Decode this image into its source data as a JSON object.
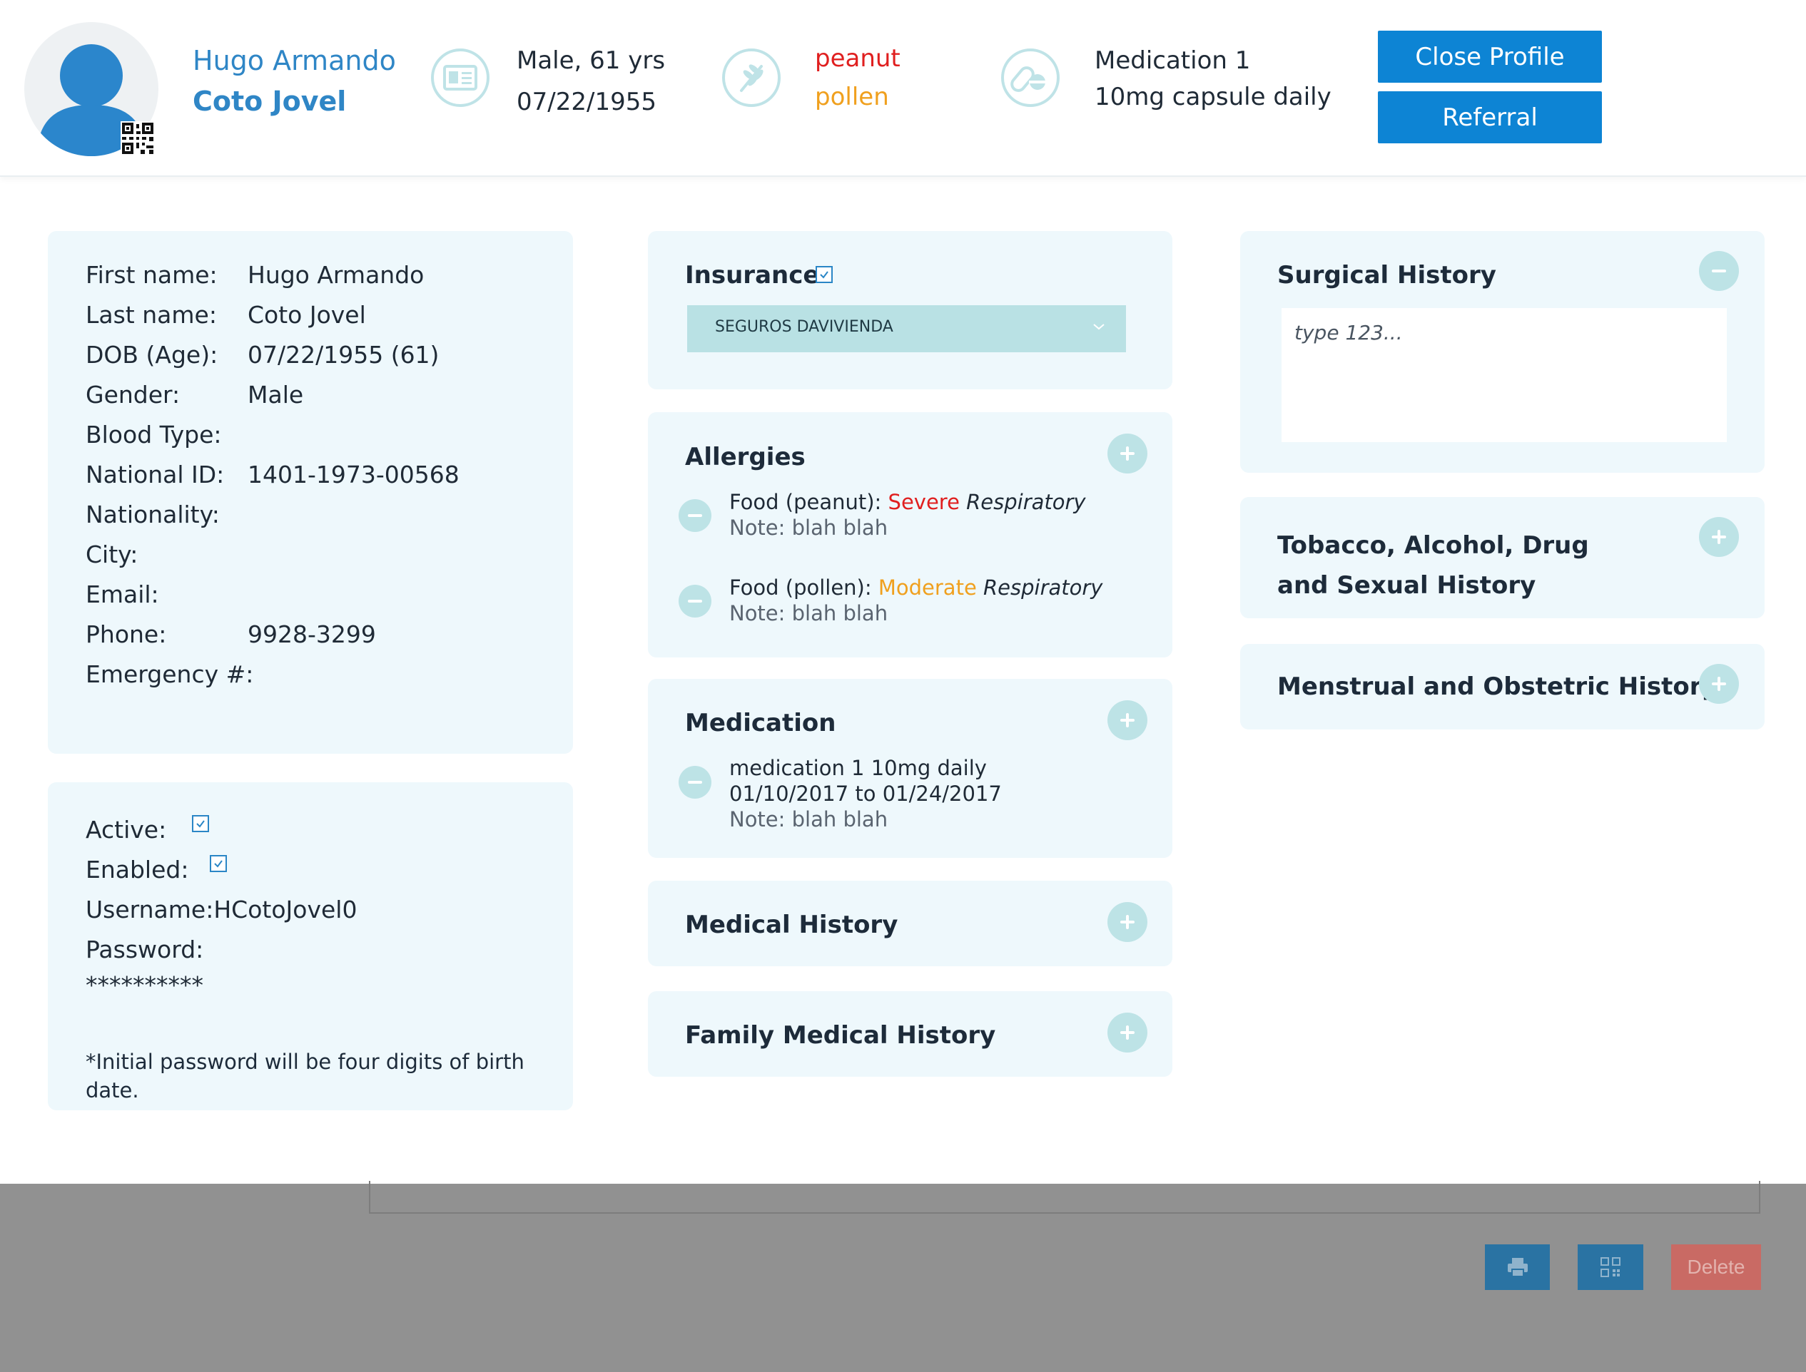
{
  "header": {
    "first_name": "Hugo Armando",
    "last_name": "Coto Jovel",
    "gender_age": "Male, 61 yrs",
    "dob": "07/22/1955",
    "allergy_1": "peanut",
    "allergy_2": "pollen",
    "medication_name": "Medication 1",
    "medication_dose": "10mg capsule daily",
    "close_profile_label": "Close Profile",
    "referral_label": "Referral"
  },
  "personal": {
    "labels": {
      "first_name": "First name:",
      "last_name": "Last name:",
      "dob": "DOB (Age):",
      "gender": "Gender:",
      "blood_type": "Blood Type:",
      "national_id": "National ID:",
      "nationality": "Nationality:",
      "city": "City:",
      "email": "Email:",
      "phone": "Phone:",
      "emergency": "Emergency #:"
    },
    "values": {
      "first_name": "Hugo Armando",
      "last_name": "Coto Jovel",
      "dob": "07/22/1955 (61)",
      "gender": "Male",
      "national_id": "1401-1973-00568",
      "phone": "9928-3299"
    }
  },
  "account": {
    "active_label": "Active:",
    "active_checked": true,
    "enabled_label": "Enabled:",
    "enabled_checked": true,
    "username_label": "Username:",
    "username_value": "HCotoJovel0",
    "password_label": "Password:",
    "password_value": "**********",
    "password_note": "*Initial password will be four digits of birth date."
  },
  "insurance": {
    "title": "Insurance",
    "checked": true,
    "selected": "SEGUROS DAVIVIENDA"
  },
  "allergies": {
    "title": "Allergies",
    "items": [
      {
        "prefix": "Food (peanut): ",
        "severity": "Severe",
        "severity_color": "#e01f1f",
        "type": "Respiratory",
        "note": "Note: blah blah"
      },
      {
        "prefix": "Food (pollen): ",
        "severity": "Moderate",
        "severity_color": "#f0a01e",
        "type": "Respiratory",
        "note": "Note: blah blah"
      }
    ]
  },
  "medication": {
    "title": "Medication",
    "line1": "medication 1 10mg daily",
    "line2": "01/10/2017 to 01/24/2017",
    "note": "Note: blah blah"
  },
  "medical_history": {
    "title": "Medical History"
  },
  "family_history": {
    "title": "Family Medical History"
  },
  "surgical_history": {
    "title": "Surgical History",
    "placeholder": "type 123..."
  },
  "tobacco_history": {
    "title_line1": "Tobacco, Alcohol, Drug",
    "title_line2": "and Sexual History"
  },
  "menstrual_history": {
    "title": "Menstrual and Obstetric History"
  },
  "footer": {
    "delete_label": "Delete"
  },
  "colors": {
    "accent_blue": "#0d84d4",
    "card_bg": "#eef8fc",
    "severe": "#e01f1f",
    "moderate": "#f0a01e",
    "delete": "#c96a64"
  }
}
